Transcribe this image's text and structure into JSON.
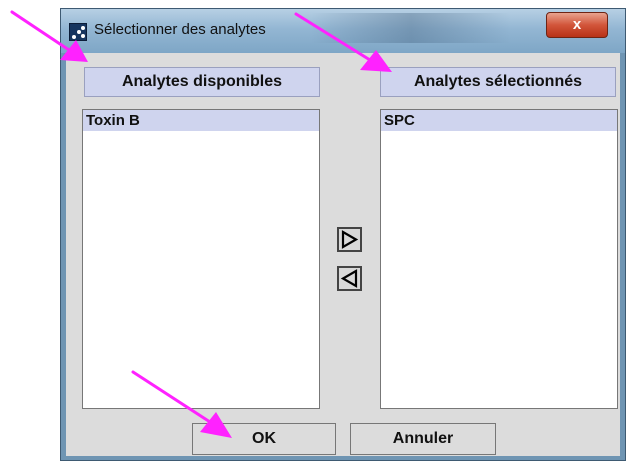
{
  "window": {
    "title": "Sélectionner des analytes",
    "close_label": "x"
  },
  "panels": {
    "available": {
      "header": "Analytes disponibles",
      "items": [
        "Toxin B"
      ]
    },
    "selected": {
      "header": "Analytes sélectionnés",
      "items": [
        "SPC"
      ]
    }
  },
  "controls": {
    "add_icon": "triangle-right-icon",
    "remove_icon": "triangle-left-icon"
  },
  "footer": {
    "ok_label": "OK",
    "cancel_label": "Annuler"
  },
  "colors": {
    "accent": "#ff22ff",
    "list_highlight": "#cfd4ee",
    "close_red": "#d2553a"
  }
}
